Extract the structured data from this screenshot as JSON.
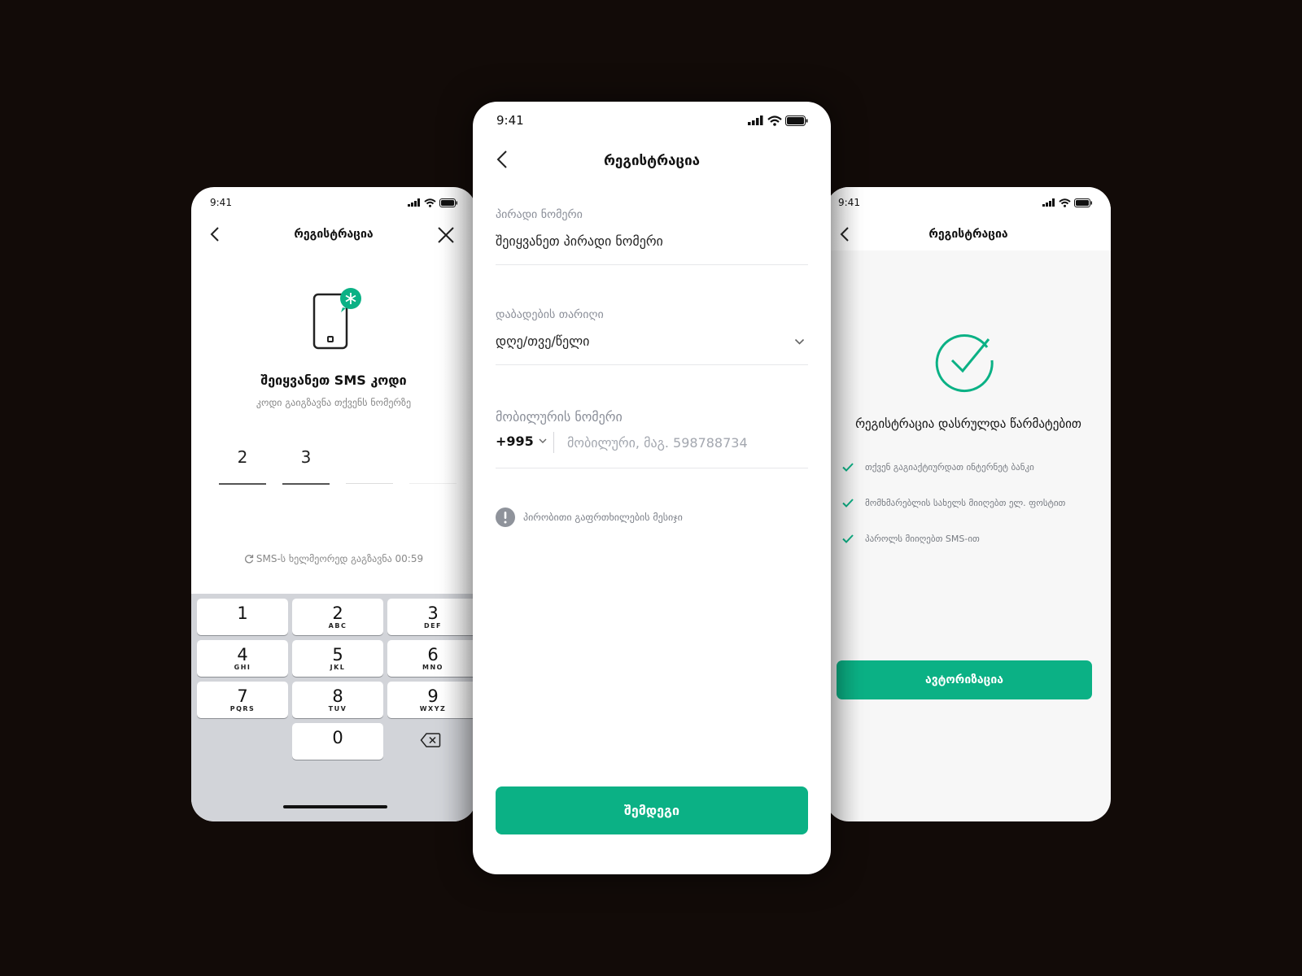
{
  "status_time": "9:41",
  "left_screen": {
    "title": "რეგისტრაცია",
    "heading": "შეიყვანეთ SMS კოდი",
    "subtitle": "კოდი გაიგზავნა თქვენს ნომერზე",
    "code_digits": [
      "2",
      "3",
      "",
      ""
    ],
    "resend_text": "SMS-ს ხელმეორედ გაგზავნა 00:59",
    "keypad": [
      {
        "digit": "1",
        "letters": ""
      },
      {
        "digit": "2",
        "letters": "ABC"
      },
      {
        "digit": "3",
        "letters": "DEF"
      },
      {
        "digit": "4",
        "letters": "GHI"
      },
      {
        "digit": "5",
        "letters": "JKL"
      },
      {
        "digit": "6",
        "letters": "MNO"
      },
      {
        "digit": "7",
        "letters": "PQRS"
      },
      {
        "digit": "8",
        "letters": "TUV"
      },
      {
        "digit": "9",
        "letters": "WXYZ"
      },
      {
        "digit": "0",
        "letters": ""
      }
    ]
  },
  "center_screen": {
    "title": "რეგისტრაცია",
    "personal_number": {
      "label": "პირადი ნომერი",
      "placeholder": "შეიყვანეთ პირადი ნომერი"
    },
    "birth_date": {
      "label": "დაბადების თარიღი",
      "placeholder": "დღე/თვე/წელი"
    },
    "mobile": {
      "label": "მობილურის ნომერი",
      "country_code": "+995",
      "placeholder": "მობილური, მაგ. 598788734"
    },
    "warning_text": "პირობითი გაფრთხილების მესიჯი",
    "next_button": "შემდეგი"
  },
  "right_screen": {
    "title": "რეგისტრაცია",
    "heading": "რეგისტრაცია დასრულდა წარმატებით",
    "checklist": [
      "თქვენ გაგიაქტიურდათ ინტერნეტ ბანკი",
      "მომხმარებლის სახელს მიიღებთ ელ. ფოსტით",
      "პაროლს მიიღებთ SMS-ით"
    ],
    "auth_button": "ავტორიზაცია"
  },
  "colors": {
    "accent": "#0bb185",
    "background": "#120b08",
    "keypad": "#d2d4d9"
  }
}
